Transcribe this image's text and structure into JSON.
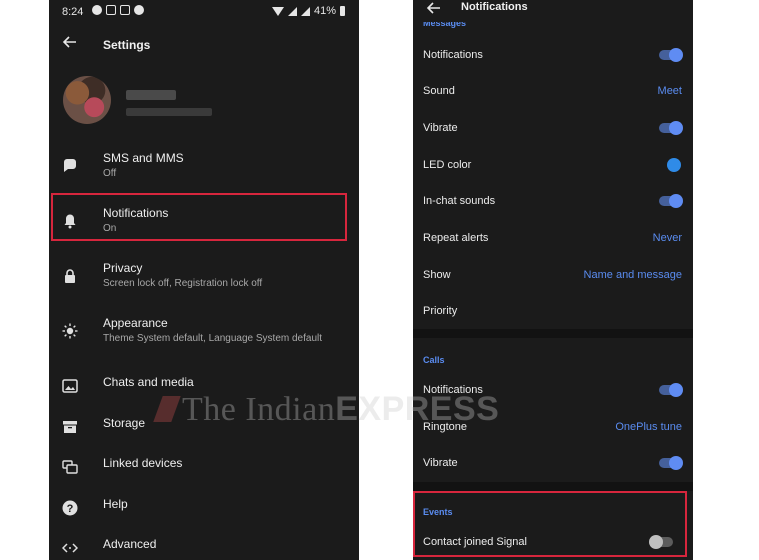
{
  "status_bar": {
    "time": "8:24",
    "battery": "41%"
  },
  "left_screen": {
    "title": "Settings",
    "items": [
      {
        "title": "SMS and MMS",
        "subtitle": "Off",
        "icon": "chat-bubble-icon"
      },
      {
        "title": "Notifications",
        "subtitle": "On",
        "icon": "bell-icon"
      },
      {
        "title": "Privacy",
        "subtitle": "Screen lock off, Registration lock off",
        "icon": "lock-icon"
      },
      {
        "title": "Appearance",
        "subtitle": "Theme System default, Language System default",
        "icon": "brightness-icon"
      },
      {
        "title": "Chats and media",
        "icon": "image-icon"
      },
      {
        "title": "Storage",
        "icon": "storage-box-icon"
      },
      {
        "title": "Linked devices",
        "icon": "linked-devices-icon"
      },
      {
        "title": "Help",
        "icon": "help-icon"
      },
      {
        "title": "Advanced",
        "icon": "code-icon"
      }
    ]
  },
  "right_screen": {
    "title": "Notifications",
    "messages_section": "Messages",
    "messages": [
      {
        "label": "Notifications",
        "control": "toggle",
        "state": "on"
      },
      {
        "label": "Sound",
        "value": "Meet"
      },
      {
        "label": "Vibrate",
        "control": "toggle",
        "state": "on"
      },
      {
        "label": "LED color",
        "control": "color-dot"
      },
      {
        "label": "In-chat sounds",
        "control": "toggle",
        "state": "on"
      },
      {
        "label": "Repeat alerts",
        "value": "Never"
      },
      {
        "label": "Show",
        "value": "Name and message"
      },
      {
        "label": "Priority"
      }
    ],
    "calls_section": "Calls",
    "calls": [
      {
        "label": "Notifications",
        "control": "toggle",
        "state": "on"
      },
      {
        "label": "Ringtone",
        "value": "OnePlus tune"
      },
      {
        "label": "Vibrate",
        "control": "toggle",
        "state": "on"
      }
    ],
    "events_section": "Events",
    "events": [
      {
        "label": "Contact joined Signal",
        "control": "toggle",
        "state": "off"
      }
    ]
  },
  "watermark": {
    "part1": "The Indian",
    "part2": "EXPRESS"
  },
  "colors": {
    "accent": "#5a8cf0",
    "highlight": "#d7263d",
    "background": "#1b1b1b"
  }
}
